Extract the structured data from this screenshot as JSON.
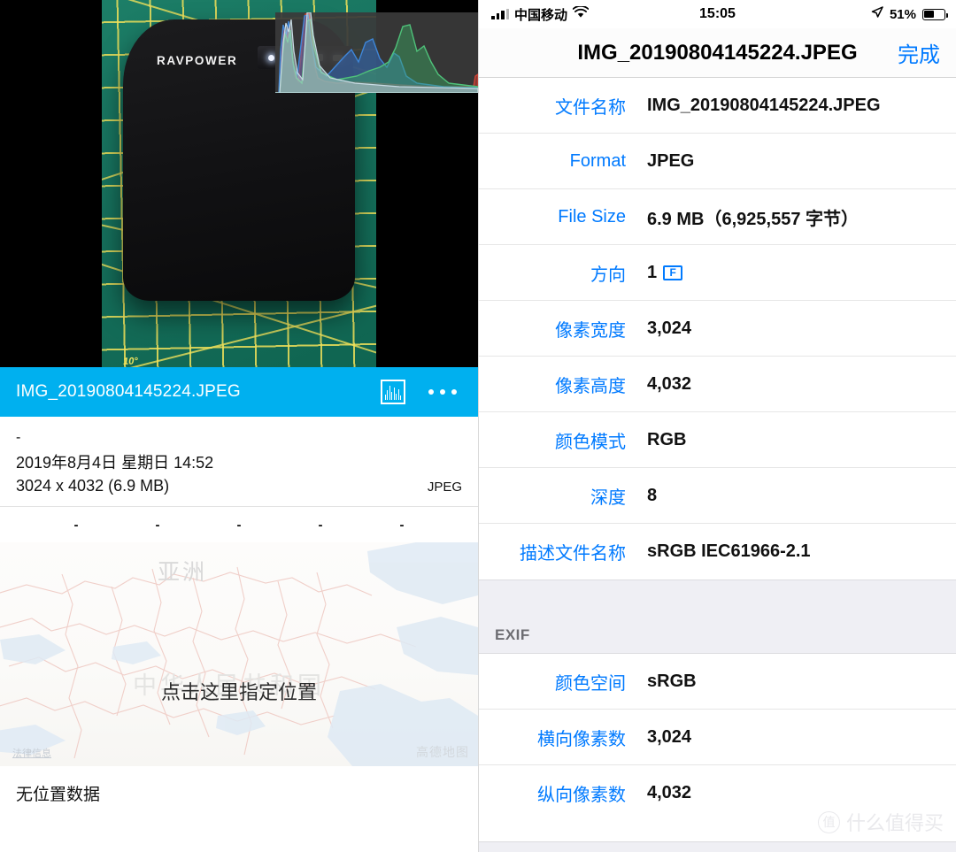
{
  "status_bar": {
    "carrier": "中国移动",
    "time": "15:05",
    "battery_percent": "51%",
    "battery_level": 51,
    "signal_icon": "cellular-signal-icon",
    "wifi_icon": "wifi-icon",
    "location_icon": "location-arrow-icon",
    "battery_icon": "battery-icon"
  },
  "nav": {
    "title": "IMG_20190804145224.JPEG",
    "done_label": "完成"
  },
  "metadata": {
    "rows": [
      {
        "label": "文件名称",
        "value": "IMG_20190804145224.JPEG"
      },
      {
        "label": "Format",
        "value": "JPEG"
      },
      {
        "label": "File Size",
        "value": "6.9 MB（6,925,557 字节）"
      },
      {
        "label": "方向",
        "value": "1",
        "icon": "orientation-icon",
        "icon_glyph": "F"
      },
      {
        "label": "像素宽度",
        "value": "3,024"
      },
      {
        "label": "像素高度",
        "value": "4,032"
      },
      {
        "label": "颜色模式",
        "value": "RGB"
      },
      {
        "label": "深度",
        "value": "8"
      },
      {
        "label": "描述文件名称",
        "value": "sRGB IEC61966-2.1"
      }
    ]
  },
  "exif": {
    "section_title": "EXIF",
    "rows": [
      {
        "label": "颜色空间",
        "value": "sRGB"
      },
      {
        "label": "横向像素数",
        "value": "3,024"
      },
      {
        "label": "纵向像素数",
        "value": "4,032"
      }
    ]
  },
  "watermark": {
    "logo_text": "值",
    "text": "什么值得买"
  },
  "viewer": {
    "photo": {
      "device_brand": "RAVPOWER",
      "mat_angle_label": "10°",
      "led_count": 5
    },
    "histogram_overlay_icon": "rgb-histogram-overlay",
    "title_bar": {
      "filename": "IMG_20190804145224.JPEG",
      "histogram_icon": "histogram-icon",
      "more_icon": "more-options-icon"
    },
    "info": {
      "title_dash": "-",
      "date": "2019年8月4日 星期日 14:52",
      "dimensions": "3024 x 4032 (6.9 MB)",
      "format": "JPEG"
    },
    "dash_row": [
      "-",
      "-",
      "-",
      "-",
      "-"
    ],
    "map": {
      "asia_label": "亚洲",
      "china_label": "中华人民共和国",
      "cta": "点击这里指定位置",
      "legal_label": "法律信息",
      "attribution": "高德地图"
    },
    "no_location": "无位置数据"
  },
  "colors": {
    "cyan_bar": "#00b0ef",
    "ios_blue": "#007aff",
    "section_bg": "#efeff4"
  }
}
